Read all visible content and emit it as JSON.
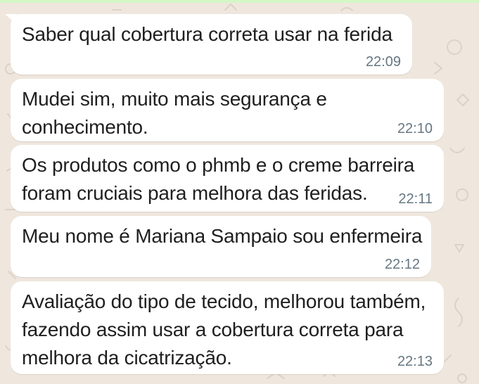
{
  "chat": {
    "messages": [
      {
        "text": "Saber qual cobertura correta usar  na ferida",
        "time": "22:09"
      },
      {
        "text": "Mudei sim, muito mais segurança e\nconhecimento.",
        "time": "22:10"
      },
      {
        "text": "Os produtos como o phmb e o creme barreira\nforam cruciais para melhora das feridas.",
        "time": "22:11"
      },
      {
        "text": "Meu nome é Mariana Sampaio sou enfermeira",
        "time": "22:12"
      },
      {
        "text": "Avaliação do tipo de tecido, melhorou também,\nfazendo assim usar a cobertura correta para\nmelhora da cicatrização.",
        "time": "22:13"
      }
    ]
  },
  "colors": {
    "background": "#efe7dd",
    "bubble": "#ffffff",
    "text": "#1f1f1f",
    "timestamp": "#667781",
    "top_strip": "#d3f7c6"
  }
}
